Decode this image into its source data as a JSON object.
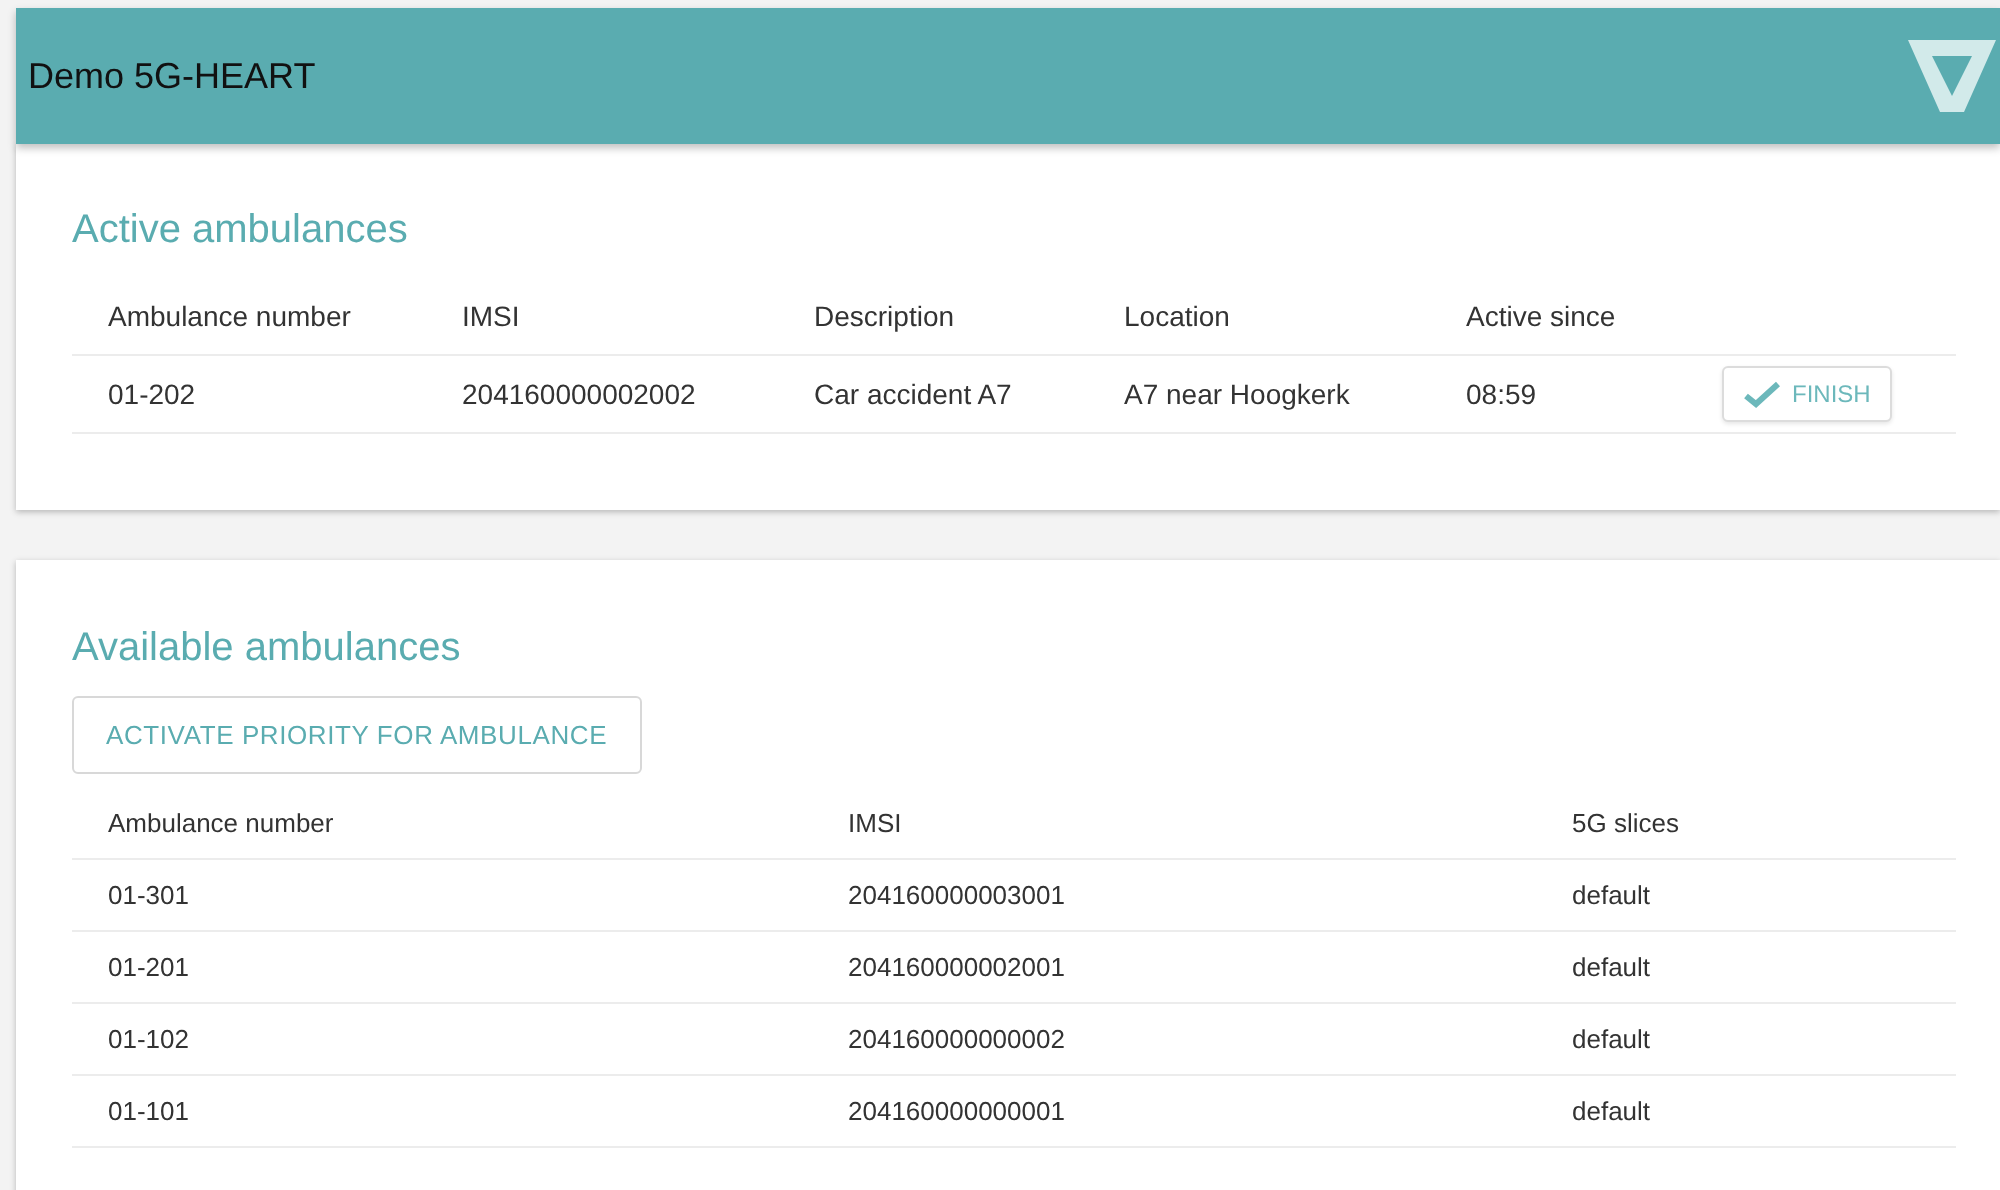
{
  "app_bar": {
    "title": "Demo 5G-HEART"
  },
  "active": {
    "title": "Active ambulances",
    "columns": [
      "Ambulance number",
      "IMSI",
      "Description",
      "Location",
      "Active since"
    ],
    "rows": [
      {
        "cells": [
          "01-202",
          "204160000002002",
          "Car accident A7",
          "A7 near Hoogkerk",
          "08:59"
        ],
        "action": "FINISH"
      }
    ]
  },
  "available": {
    "title": "Available ambulances",
    "button": "ACTIVATE PRIORITY FOR AMBULANCE",
    "columns": [
      "Ambulance number",
      "IMSI",
      "5G slices"
    ],
    "rows": [
      [
        "01-301",
        "204160000003001",
        "default"
      ],
      [
        "01-201",
        "204160000002001",
        "default"
      ],
      [
        "01-102",
        "204160000000002",
        "default"
      ],
      [
        "01-101",
        "204160000000001",
        "default"
      ]
    ]
  }
}
